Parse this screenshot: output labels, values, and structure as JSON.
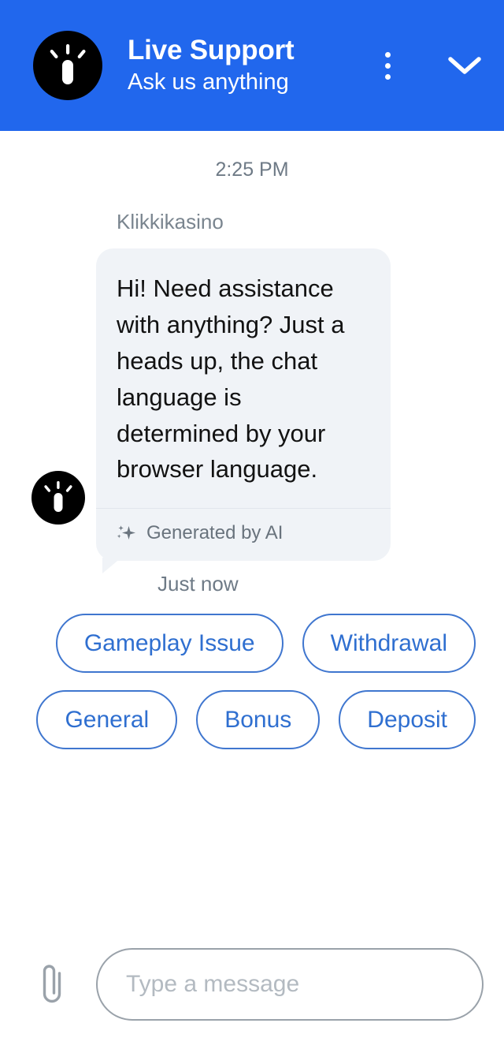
{
  "header": {
    "title": "Live Support",
    "subtitle": "Ask us anything",
    "avatar_icon": "lightbulb-logo-icon",
    "menu_icon": "more-vertical-icon",
    "minimize_icon": "chevron-down-icon",
    "background_color": "#2167ed"
  },
  "conversation": {
    "timestamp": "2:25 PM",
    "message": {
      "sender": "Klikkikasino",
      "text": "Hi! Need assistance with anything? Just a heads up, the chat language is determined by your browser language.",
      "ai_disclaimer": "Generated by AI",
      "ai_icon": "sparkle-icon",
      "meta": "Just now",
      "avatar_icon": "lightbulb-logo-icon",
      "bubble_color": "#f0f3f7"
    }
  },
  "quick_replies": {
    "accent_color": "#2f6fd0",
    "options": [
      {
        "label": "Gameplay Issue"
      },
      {
        "label": "Withdrawal"
      },
      {
        "label": "General"
      },
      {
        "label": "Bonus"
      },
      {
        "label": "Deposit"
      }
    ]
  },
  "composer": {
    "attach_icon": "paperclip-icon",
    "placeholder": "Type a message",
    "value": ""
  }
}
